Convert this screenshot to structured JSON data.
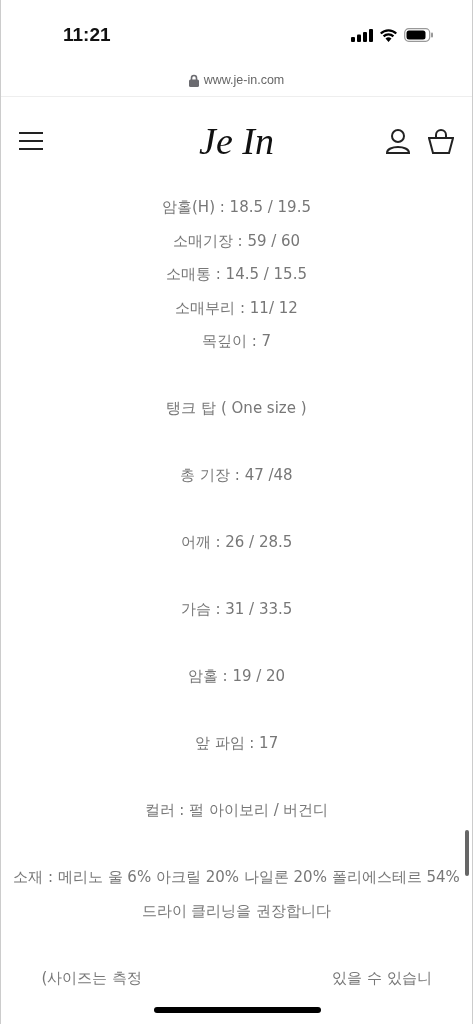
{
  "status_bar": {
    "time": "11:21"
  },
  "address_bar": {
    "url": "www.je-in.com"
  },
  "header": {
    "logo": "Je In"
  },
  "blocks": [
    {
      "lines": [
        "암홀(H) : 18.5 / 19.5",
        "소매기장 : 59 / 60",
        "소매통 : 14.5 / 15.5",
        "소매부리 : 11/ 12",
        "목깊이 : 7"
      ]
    },
    {
      "lines": [
        "탱크 탑 ( One size )"
      ]
    },
    {
      "lines": [
        "총 기장 : 47 /48"
      ]
    },
    {
      "lines": [
        "어깨 : 26 / 28.5"
      ]
    },
    {
      "lines": [
        "가슴 : 31 / 33.5"
      ]
    },
    {
      "lines": [
        "암홀 : 19 / 20"
      ]
    },
    {
      "lines": [
        "앞 파임 : 17"
      ]
    },
    {
      "lines": [
        "컬러 : 펄 아이보리 / 버건디"
      ]
    },
    {
      "lines": [
        "소재 : 메리노 울 6% 아크릴 20% 나일론 20% 폴리에스테르 54%",
        "드라이 클리닝을 권장합니다"
      ]
    },
    {
      "parts": [
        "(사이즈는 측정",
        "있을 수 있습니"
      ]
    }
  ]
}
